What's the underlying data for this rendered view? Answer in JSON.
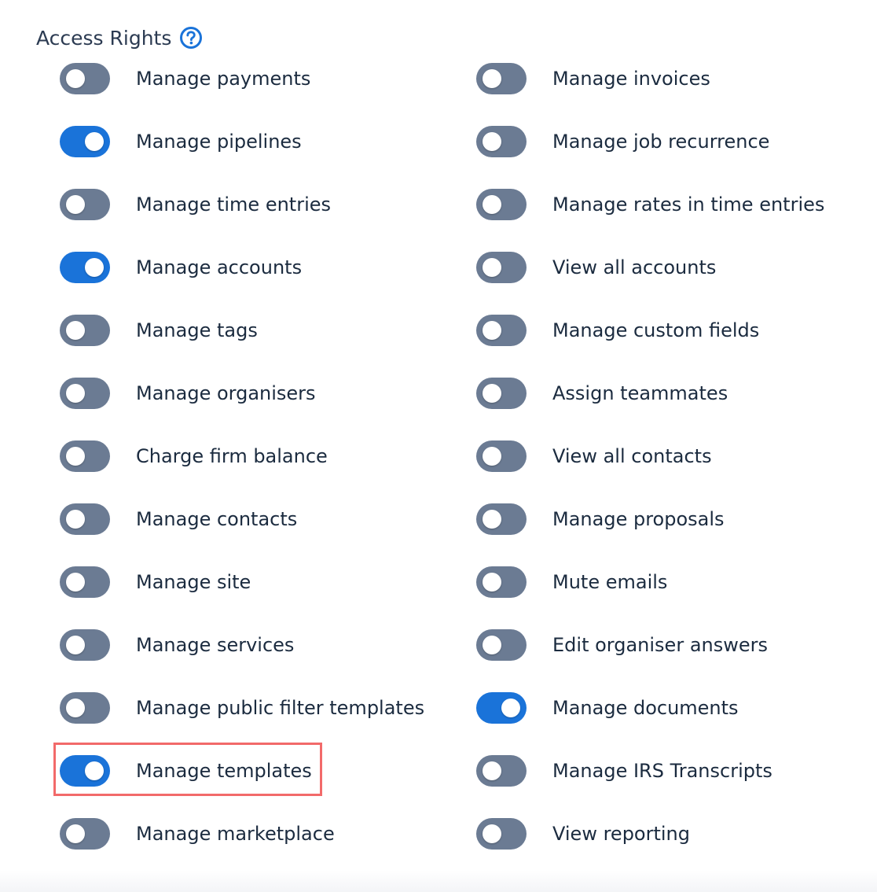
{
  "section": {
    "title": "Access Rights",
    "help_icon": "question-circle-icon"
  },
  "colors": {
    "toggle_on": "#1a73d9",
    "toggle_off": "#6b7b93",
    "highlight": "#f26a6a",
    "text": "#1b2b3f"
  },
  "permissions_left": [
    {
      "label": "Manage payments",
      "enabled": false
    },
    {
      "label": "Manage pipelines",
      "enabled": true
    },
    {
      "label": "Manage time entries",
      "enabled": false
    },
    {
      "label": "Manage accounts",
      "enabled": true
    },
    {
      "label": "Manage tags",
      "enabled": false
    },
    {
      "label": "Manage organisers",
      "enabled": false
    },
    {
      "label": "Charge firm balance",
      "enabled": false
    },
    {
      "label": "Manage contacts",
      "enabled": false
    },
    {
      "label": "Manage site",
      "enabled": false
    },
    {
      "label": "Manage services",
      "enabled": false
    },
    {
      "label": "Manage public filter templates",
      "enabled": false
    },
    {
      "label": "Manage templates",
      "enabled": true
    },
    {
      "label": "Manage marketplace",
      "enabled": false
    }
  ],
  "permissions_right": [
    {
      "label": "Manage invoices",
      "enabled": false
    },
    {
      "label": "Manage job recurrence",
      "enabled": false
    },
    {
      "label": "Manage rates in time entries",
      "enabled": false
    },
    {
      "label": "View all accounts",
      "enabled": false
    },
    {
      "label": "Manage custom fields",
      "enabled": false
    },
    {
      "label": "Assign teammates",
      "enabled": false
    },
    {
      "label": "View all contacts",
      "enabled": false
    },
    {
      "label": "Manage proposals",
      "enabled": false
    },
    {
      "label": "Mute emails",
      "enabled": false
    },
    {
      "label": "Edit organiser answers",
      "enabled": false
    },
    {
      "label": "Manage documents",
      "enabled": true
    },
    {
      "label": "Manage IRS Transcripts",
      "enabled": false
    },
    {
      "label": "View reporting",
      "enabled": false
    }
  ]
}
